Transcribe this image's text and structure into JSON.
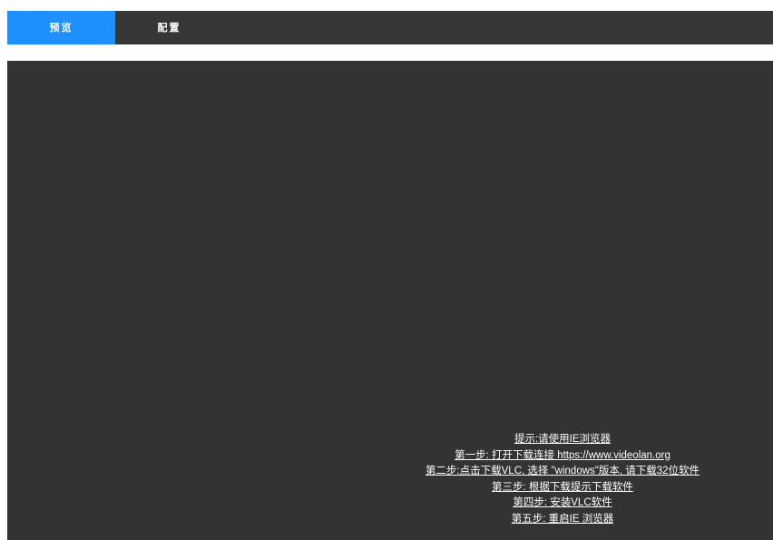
{
  "tabs": [
    {
      "label": "预览",
      "active": true
    },
    {
      "label": "配置",
      "active": false
    }
  ],
  "colors": {
    "tab_bar": "#363636",
    "tab_active": "#1e90ff",
    "viewer_background": "#333333",
    "tip_text": "#ffffff"
  },
  "tips": {
    "lines": [
      "提示:请使用IE浏览器",
      "第一步: 打开下载连接 https://www.videolan.org",
      "第二步:点击下载VLC, 选择 \"windows\"版本, 请下载32位软件",
      "第三步: 根据下载提示下载软件",
      "第四步: 安装VLC软件",
      "第五步: 重启IE 浏览器"
    ]
  }
}
